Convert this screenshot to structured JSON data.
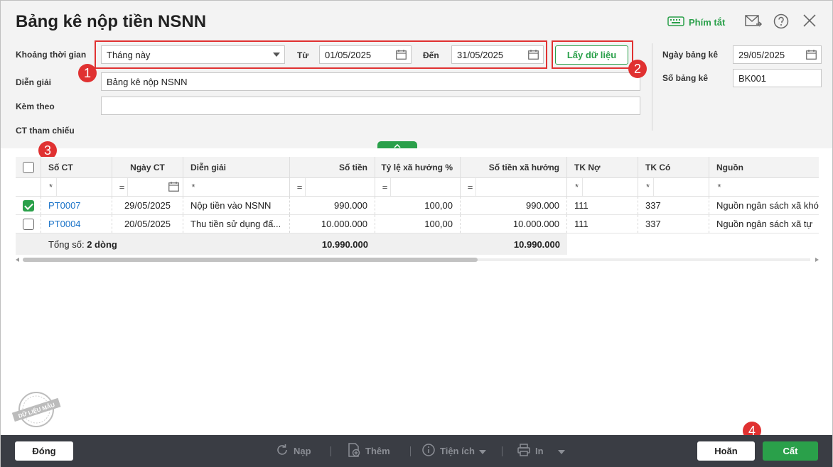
{
  "window": {
    "title": "Bảng kê nộp tiền NSNN",
    "shortcut_label": "Phím tắt"
  },
  "form": {
    "period_label": "Khoảng thời gian",
    "period_value": "Tháng này",
    "from_label": "Từ",
    "from_value": "01/05/2025",
    "to_label": "Đến",
    "to_value": "31/05/2025",
    "fetch_label": "Lấy dữ liệu",
    "desc_label": "Diễn giải",
    "desc_value": "Bảng kê nộp NSNN",
    "attach_label": "Kèm theo",
    "attach_value": "",
    "ref_label": "CT tham chiếu",
    "date_label": "Ngày bảng kê",
    "date_value": "29/05/2025",
    "number_label": "Số bảng kê",
    "number_value": "BK001"
  },
  "callouts": [
    "1",
    "2",
    "3",
    "4"
  ],
  "grid": {
    "columns": [
      "Số CT",
      "Ngày CT",
      "Diễn giải",
      "Số tiền",
      "Tỷ lệ xã hưởng %",
      "Số tiền xã hưởng",
      "TK Nợ",
      "TK Có",
      "Nguồn"
    ],
    "filters": [
      "*",
      "=",
      "*",
      "=",
      "=",
      "=",
      "*",
      "*",
      "*"
    ],
    "rows": [
      {
        "checked": true,
        "so_ct": "PT0007",
        "ngay_ct": "29/05/2025",
        "dien_giai": "Nộp tiền vào NSNN",
        "so_tien": "990.000",
        "ty_le": "100,00",
        "so_tien_xh": "990.000",
        "tk_no": "111",
        "tk_co": "337",
        "nguon": "Nguồn ngân sách xã khó"
      },
      {
        "checked": false,
        "so_ct": "PT0004",
        "ngay_ct": "20/05/2025",
        "dien_giai": "Thu tiền sử dụng đấ...",
        "so_tien": "10.000.000",
        "ty_le": "100,00",
        "so_tien_xh": "10.000.000",
        "tk_no": "111",
        "tk_co": "337",
        "nguon": "Nguồn ngân sách xã tự"
      }
    ],
    "total_label": "Tổng số: ",
    "total_count": "2 dòng",
    "total_amount": "10.990.000",
    "total_shared": "10.990.000"
  },
  "watermark": "DỮ LIỆU MẪU",
  "footer": {
    "close_label": "Đóng",
    "reload_label": "Nạp",
    "add_label": "Thêm",
    "utility_label": "Tiện ích",
    "print_label": "In",
    "cancel_label": "Hoãn",
    "save_label": "Cất"
  },
  "colors": {
    "accent": "#2aa04a",
    "callout": "#e03131",
    "link": "#1a73c8",
    "footer_bg": "#3a3d44"
  }
}
